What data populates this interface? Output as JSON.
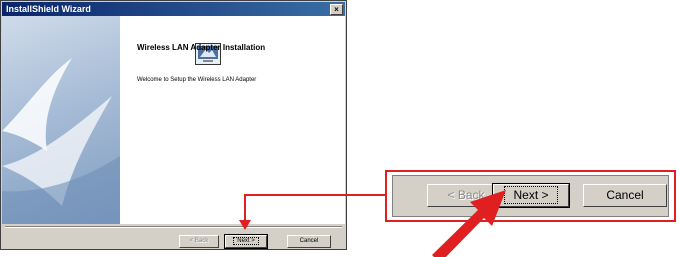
{
  "window": {
    "title": "InstallShield Wizard",
    "close_glyph": "×"
  },
  "content": {
    "heading": "Wireless LAN Adapter Installation",
    "welcome": "Welcome to Setup the Wireless LAN Adapter"
  },
  "buttons": {
    "back": "< Back",
    "next": "Next >",
    "cancel": "Cancel"
  },
  "zoom_buttons": {
    "back": "< Back",
    "next": "Next >",
    "cancel": "Cancel"
  },
  "colors": {
    "titlebar_start": "#0a246a",
    "titlebar_end": "#3a6ea5",
    "highlight": "#e02020",
    "dialog_bg": "#d4d0c8"
  },
  "icons": {
    "setup_icon": "setup-computer-icon",
    "pointer": "pointer-arrow-icon"
  }
}
